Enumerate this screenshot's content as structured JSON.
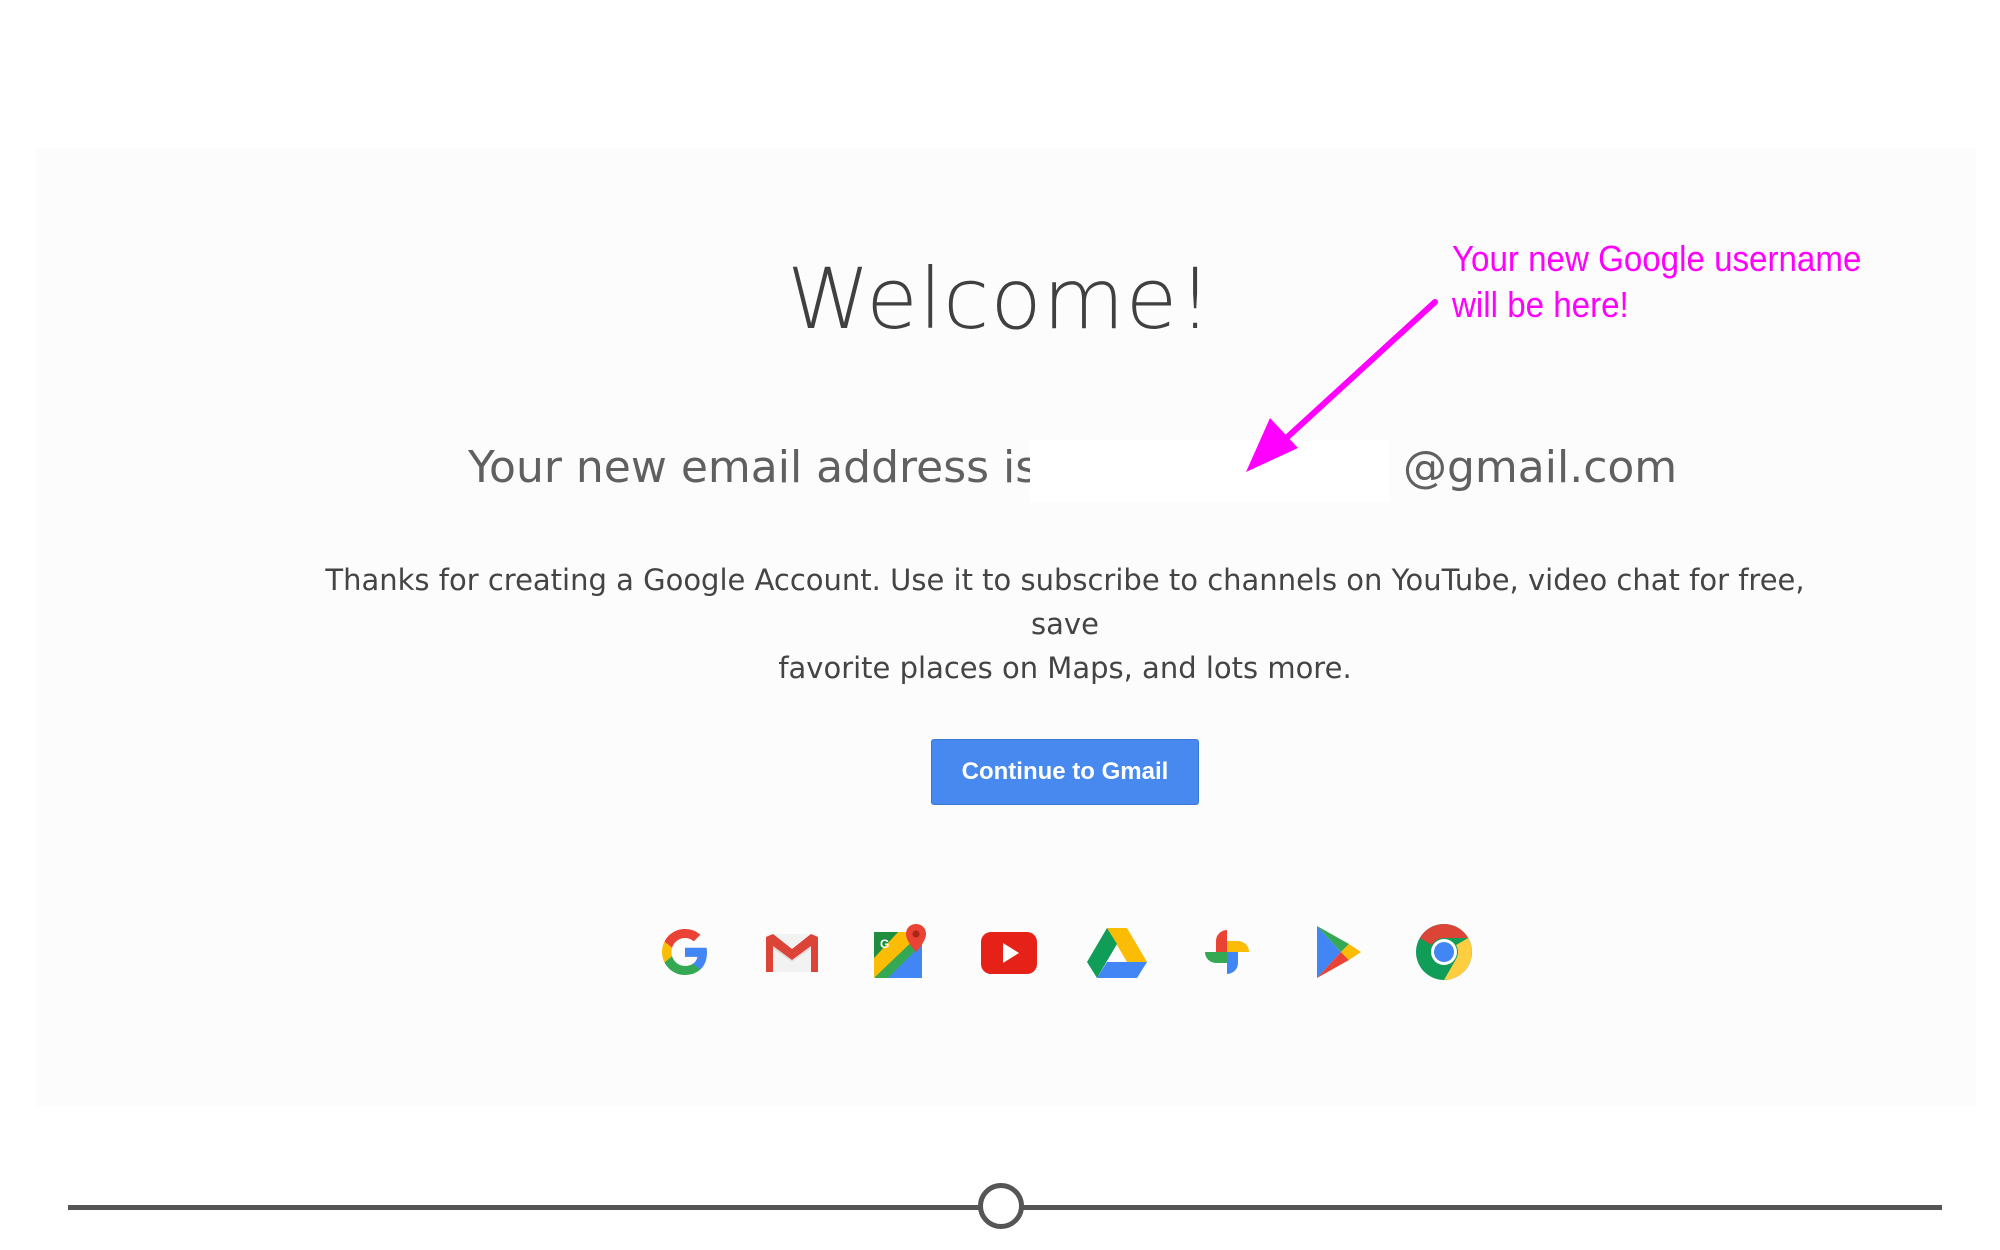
{
  "welcome": {
    "title": "Welcome!",
    "email_prefix": "Your new email address is",
    "email_username": "",
    "email_suffix": "@gmail.com",
    "message_line1": "Thanks for creating a Google Account. Use it to subscribe to channels on YouTube, video chat for free, save",
    "message_line2": "favorite places on Maps, and lots more.",
    "continue_button": "Continue to Gmail"
  },
  "apps": [
    {
      "icon": "google-icon"
    },
    {
      "icon": "gmail-icon"
    },
    {
      "icon": "maps-icon"
    },
    {
      "icon": "youtube-icon"
    },
    {
      "icon": "drive-icon"
    },
    {
      "icon": "photos-icon"
    },
    {
      "icon": "play-icon"
    },
    {
      "icon": "chrome-icon"
    }
  ],
  "annotation": {
    "line1": "Your new Google username",
    "line2": "will be here!",
    "color": "#ff00ff"
  },
  "slider": {
    "value": 0.5
  },
  "colors": {
    "button": "#4889f0",
    "google_blue": "#4285f4",
    "google_red": "#ea4335",
    "google_yellow": "#fbbc05",
    "google_green": "#34a853"
  }
}
